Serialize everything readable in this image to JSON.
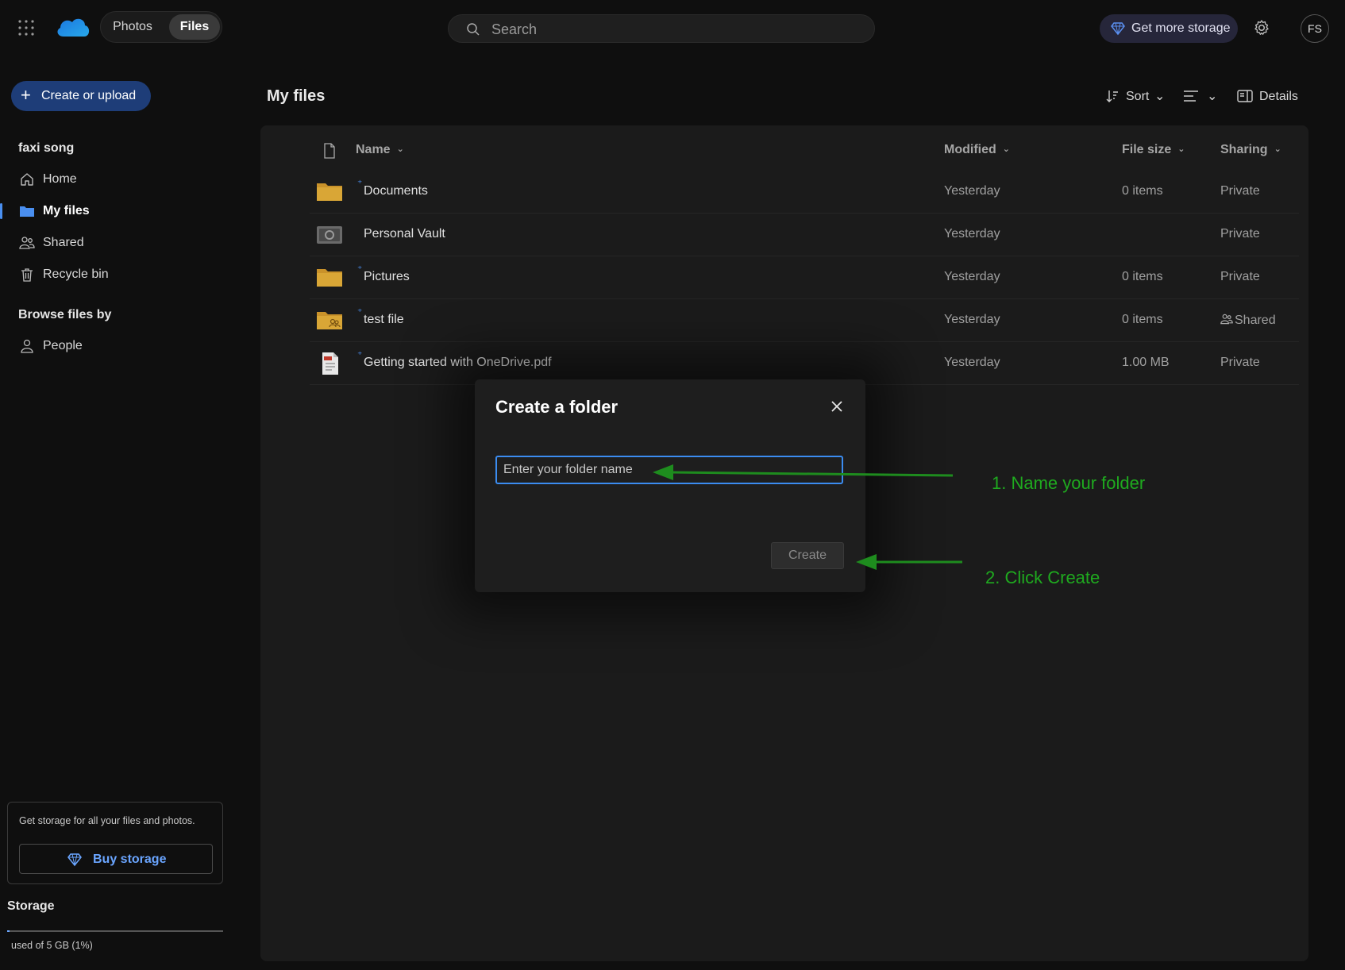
{
  "header": {
    "tabs": [
      {
        "label": "Photos"
      },
      {
        "label": "Files"
      }
    ],
    "search_placeholder": "Search",
    "get_storage_label": "Get more storage",
    "avatar_initials": "FS"
  },
  "sidebar": {
    "create_label": "Create or upload",
    "user_name": "faxi song",
    "items": [
      {
        "label": "Home",
        "icon": "home-icon"
      },
      {
        "label": "My files",
        "icon": "folder-icon"
      },
      {
        "label": "Shared",
        "icon": "people-icon"
      },
      {
        "label": "Recycle bin",
        "icon": "trash-icon"
      }
    ],
    "browse_title": "Browse files by",
    "browse_items": [
      {
        "label": "People",
        "icon": "person-icon"
      }
    ],
    "promo_text": "Get storage for all your files and photos.",
    "buy_label": "Buy storage",
    "storage_title": "Storage",
    "storage_used_text": "used of 5 GB (1%)",
    "storage_used_percent": 1
  },
  "main": {
    "title": "My files",
    "commands": {
      "sort": "Sort",
      "details": "Details"
    },
    "columns": {
      "name": "Name",
      "modified": "Modified",
      "size": "File size",
      "sharing": "Sharing"
    },
    "rows": [
      {
        "name": "Documents",
        "modified": "Yesterday",
        "size": "0 items",
        "sharing": "Private",
        "type": "folder"
      },
      {
        "name": "Personal Vault",
        "modified": "Yesterday",
        "size": "",
        "sharing": "Private",
        "type": "vault"
      },
      {
        "name": "Pictures",
        "modified": "Yesterday",
        "size": "0 items",
        "sharing": "Private",
        "type": "folder"
      },
      {
        "name": "test file",
        "modified": "Yesterday",
        "size": "0 items",
        "sharing": "Shared",
        "type": "shared-folder"
      },
      {
        "name": "Getting started with OneDrive.pdf",
        "modified": "Yesterday",
        "size": "1.00 MB",
        "sharing": "Private",
        "type": "pdf"
      }
    ]
  },
  "dialog": {
    "title": "Create a folder",
    "input_placeholder": "Enter your folder name",
    "input_value": "",
    "create_label": "Create"
  },
  "annotations": {
    "step1": "1. Name your folder",
    "step2": "2. Click Create",
    "color": "#1faa1f"
  },
  "colors": {
    "accent": "#3b8cf0",
    "background": "#0f0f0f",
    "panel": "#1b1b1b",
    "folder": "#d9a636"
  }
}
